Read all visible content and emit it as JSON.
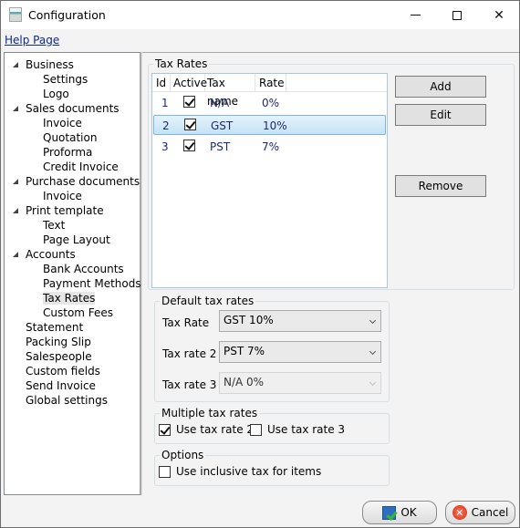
{
  "window": {
    "title": "Configuration",
    "icon": "document-icon",
    "controls": {
      "minimize": "minimize",
      "maximize": "maximize",
      "close": "✕"
    }
  },
  "help": {
    "label": "Help Page"
  },
  "tree": {
    "items": [
      {
        "label": "Business",
        "level": 0,
        "expanded": true
      },
      {
        "label": "Settings",
        "level": 1
      },
      {
        "label": "Logo",
        "level": 1
      },
      {
        "label": "Sales documents",
        "level": 0,
        "expanded": true
      },
      {
        "label": "Invoice",
        "level": 1
      },
      {
        "label": "Quotation",
        "level": 1
      },
      {
        "label": "Proforma",
        "level": 1
      },
      {
        "label": "Credit Invoice",
        "level": 1
      },
      {
        "label": "Purchase documents",
        "level": 0,
        "expanded": true
      },
      {
        "label": "Invoice",
        "level": 1
      },
      {
        "label": "Print template",
        "level": 0,
        "expanded": true
      },
      {
        "label": "Text",
        "level": 1
      },
      {
        "label": "Page Layout",
        "level": 1
      },
      {
        "label": "Accounts",
        "level": 0,
        "expanded": true
      },
      {
        "label": "Bank Accounts",
        "level": 1
      },
      {
        "label": "Payment Methods",
        "level": 1
      },
      {
        "label": "Tax Rates",
        "level": 1,
        "selected": true
      },
      {
        "label": "Custom Fees",
        "level": 1
      },
      {
        "label": "Statement",
        "level": 0
      },
      {
        "label": "Packing Slip",
        "level": 0
      },
      {
        "label": "Salespeople",
        "level": 0
      },
      {
        "label": "Custom fields",
        "level": 0
      },
      {
        "label": "Send Invoice",
        "level": 0
      },
      {
        "label": "Global settings",
        "level": 0
      }
    ]
  },
  "tax_rates": {
    "group_title": "Tax Rates",
    "columns": [
      "Id",
      "Active",
      "Tax name",
      "Rate"
    ],
    "rows": [
      {
        "id": "1",
        "active": true,
        "name": "N/A",
        "rate": "0%",
        "selected": false
      },
      {
        "id": "2",
        "active": true,
        "name": "GST",
        "rate": "10%",
        "selected": true
      },
      {
        "id": "3",
        "active": true,
        "name": "PST",
        "rate": "7%",
        "selected": false
      }
    ],
    "buttons": {
      "add": "Add",
      "edit": "Edit",
      "remove": "Remove"
    }
  },
  "default_tax_rates": {
    "group_title": "Default tax rates",
    "fields": [
      {
        "label": "Tax Rate",
        "value": "GST 10%",
        "enabled": true
      },
      {
        "label": "Tax rate 2",
        "value": "PST 7%",
        "enabled": true
      },
      {
        "label": "Tax rate 3",
        "value": "N/A 0%",
        "enabled": false
      }
    ]
  },
  "multiple_tax_rates": {
    "group_title": "Multiple tax rates",
    "use_tax_rate_2": {
      "label": "Use tax rate 2",
      "checked": true
    },
    "use_tax_rate_3": {
      "label": "Use tax rate 3",
      "checked": false
    }
  },
  "options": {
    "group_title": "Options",
    "inclusive_tax": {
      "label": "Use inclusive tax for items",
      "checked": false
    }
  },
  "footer": {
    "ok": "OK",
    "cancel": "Cancel"
  }
}
